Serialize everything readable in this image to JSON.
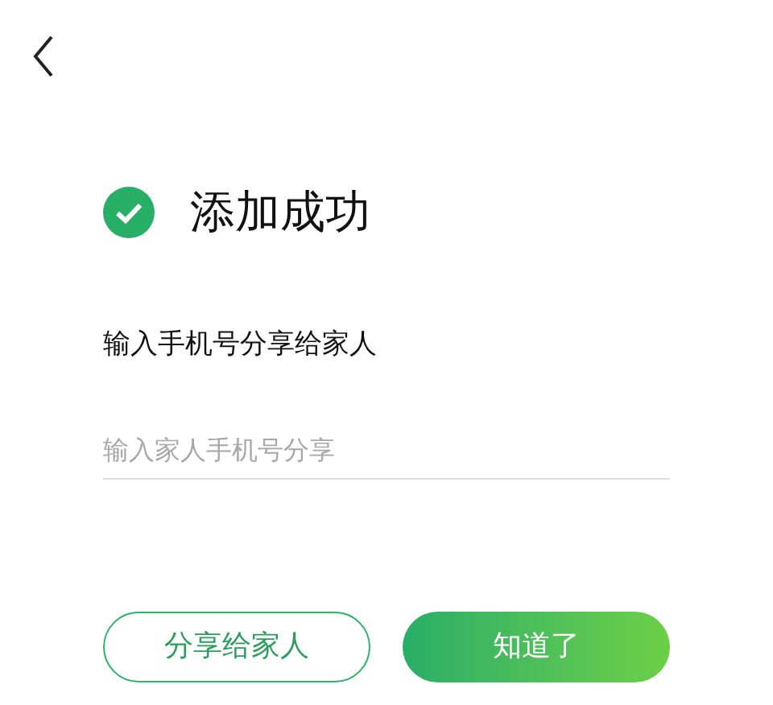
{
  "header": {
    "back": true
  },
  "result": {
    "title": "添加成功",
    "success": true
  },
  "share": {
    "label": "输入手机号分享给家人",
    "placeholder": "输入家人手机号分享"
  },
  "buttons": [
    {
      "label": "分享给家人",
      "kind": "outline"
    },
    {
      "label": "知道了",
      "kind": "primary"
    }
  ]
}
